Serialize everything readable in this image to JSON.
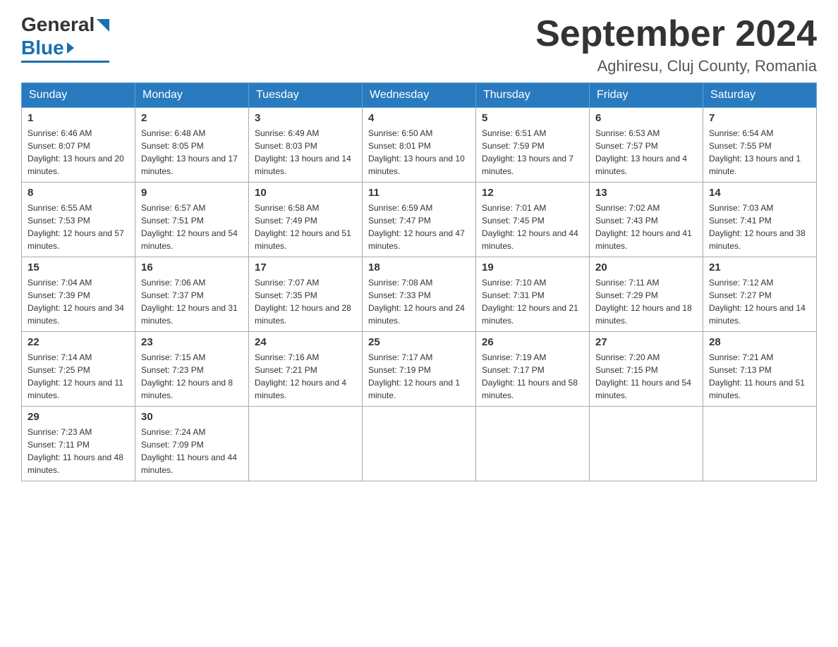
{
  "header": {
    "logo_general": "General",
    "logo_blue": "Blue",
    "month_title": "September 2024",
    "location": "Aghiresu, Cluj County, Romania"
  },
  "days_of_week": [
    "Sunday",
    "Monday",
    "Tuesday",
    "Wednesday",
    "Thursday",
    "Friday",
    "Saturday"
  ],
  "weeks": [
    [
      {
        "day": "1",
        "sunrise": "6:46 AM",
        "sunset": "8:07 PM",
        "daylight": "13 hours and 20 minutes."
      },
      {
        "day": "2",
        "sunrise": "6:48 AM",
        "sunset": "8:05 PM",
        "daylight": "13 hours and 17 minutes."
      },
      {
        "day": "3",
        "sunrise": "6:49 AM",
        "sunset": "8:03 PM",
        "daylight": "13 hours and 14 minutes."
      },
      {
        "day": "4",
        "sunrise": "6:50 AM",
        "sunset": "8:01 PM",
        "daylight": "13 hours and 10 minutes."
      },
      {
        "day": "5",
        "sunrise": "6:51 AM",
        "sunset": "7:59 PM",
        "daylight": "13 hours and 7 minutes."
      },
      {
        "day": "6",
        "sunrise": "6:53 AM",
        "sunset": "7:57 PM",
        "daylight": "13 hours and 4 minutes."
      },
      {
        "day": "7",
        "sunrise": "6:54 AM",
        "sunset": "7:55 PM",
        "daylight": "13 hours and 1 minute."
      }
    ],
    [
      {
        "day": "8",
        "sunrise": "6:55 AM",
        "sunset": "7:53 PM",
        "daylight": "12 hours and 57 minutes."
      },
      {
        "day": "9",
        "sunrise": "6:57 AM",
        "sunset": "7:51 PM",
        "daylight": "12 hours and 54 minutes."
      },
      {
        "day": "10",
        "sunrise": "6:58 AM",
        "sunset": "7:49 PM",
        "daylight": "12 hours and 51 minutes."
      },
      {
        "day": "11",
        "sunrise": "6:59 AM",
        "sunset": "7:47 PM",
        "daylight": "12 hours and 47 minutes."
      },
      {
        "day": "12",
        "sunrise": "7:01 AM",
        "sunset": "7:45 PM",
        "daylight": "12 hours and 44 minutes."
      },
      {
        "day": "13",
        "sunrise": "7:02 AM",
        "sunset": "7:43 PM",
        "daylight": "12 hours and 41 minutes."
      },
      {
        "day": "14",
        "sunrise": "7:03 AM",
        "sunset": "7:41 PM",
        "daylight": "12 hours and 38 minutes."
      }
    ],
    [
      {
        "day": "15",
        "sunrise": "7:04 AM",
        "sunset": "7:39 PM",
        "daylight": "12 hours and 34 minutes."
      },
      {
        "day": "16",
        "sunrise": "7:06 AM",
        "sunset": "7:37 PM",
        "daylight": "12 hours and 31 minutes."
      },
      {
        "day": "17",
        "sunrise": "7:07 AM",
        "sunset": "7:35 PM",
        "daylight": "12 hours and 28 minutes."
      },
      {
        "day": "18",
        "sunrise": "7:08 AM",
        "sunset": "7:33 PM",
        "daylight": "12 hours and 24 minutes."
      },
      {
        "day": "19",
        "sunrise": "7:10 AM",
        "sunset": "7:31 PM",
        "daylight": "12 hours and 21 minutes."
      },
      {
        "day": "20",
        "sunrise": "7:11 AM",
        "sunset": "7:29 PM",
        "daylight": "12 hours and 18 minutes."
      },
      {
        "day": "21",
        "sunrise": "7:12 AM",
        "sunset": "7:27 PM",
        "daylight": "12 hours and 14 minutes."
      }
    ],
    [
      {
        "day": "22",
        "sunrise": "7:14 AM",
        "sunset": "7:25 PM",
        "daylight": "12 hours and 11 minutes."
      },
      {
        "day": "23",
        "sunrise": "7:15 AM",
        "sunset": "7:23 PM",
        "daylight": "12 hours and 8 minutes."
      },
      {
        "day": "24",
        "sunrise": "7:16 AM",
        "sunset": "7:21 PM",
        "daylight": "12 hours and 4 minutes."
      },
      {
        "day": "25",
        "sunrise": "7:17 AM",
        "sunset": "7:19 PM",
        "daylight": "12 hours and 1 minute."
      },
      {
        "day": "26",
        "sunrise": "7:19 AM",
        "sunset": "7:17 PM",
        "daylight": "11 hours and 58 minutes."
      },
      {
        "day": "27",
        "sunrise": "7:20 AM",
        "sunset": "7:15 PM",
        "daylight": "11 hours and 54 minutes."
      },
      {
        "day": "28",
        "sunrise": "7:21 AM",
        "sunset": "7:13 PM",
        "daylight": "11 hours and 51 minutes."
      }
    ],
    [
      {
        "day": "29",
        "sunrise": "7:23 AM",
        "sunset": "7:11 PM",
        "daylight": "11 hours and 48 minutes."
      },
      {
        "day": "30",
        "sunrise": "7:24 AM",
        "sunset": "7:09 PM",
        "daylight": "11 hours and 44 minutes."
      },
      null,
      null,
      null,
      null,
      null
    ]
  ]
}
